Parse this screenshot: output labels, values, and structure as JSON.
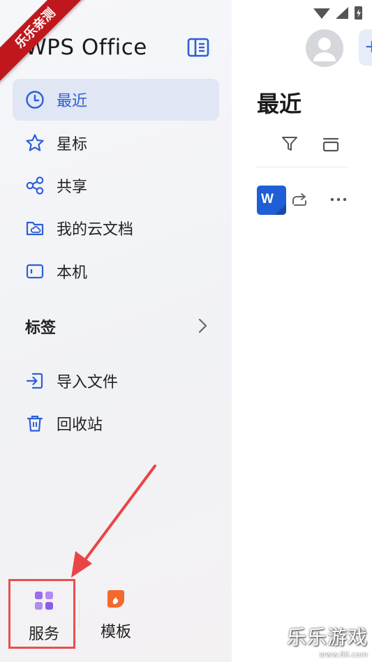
{
  "app": {
    "logo_text": "WPS Office"
  },
  "sidebar": {
    "items": [
      {
        "label": "最近",
        "active": true
      },
      {
        "label": "星标"
      },
      {
        "label": "共享"
      },
      {
        "label": "我的云文档"
      },
      {
        "label": "本机"
      }
    ],
    "tags_label": "标签",
    "tools": [
      {
        "label": "导入文件"
      },
      {
        "label": "回收站"
      }
    ]
  },
  "tabbar": {
    "tabs": [
      {
        "label": "服务"
      },
      {
        "label": "模板"
      }
    ]
  },
  "main": {
    "title": "最近",
    "add_label": "+",
    "file_badge": "W"
  },
  "watermark": {
    "ribbon": "乐乐亲测",
    "main": "乐乐游戏",
    "sub": "www.6ll.com"
  },
  "colors": {
    "accent": "#2d5fd5",
    "highlight_box": "#e84f4f",
    "word_blue": "#1e5fd7"
  }
}
